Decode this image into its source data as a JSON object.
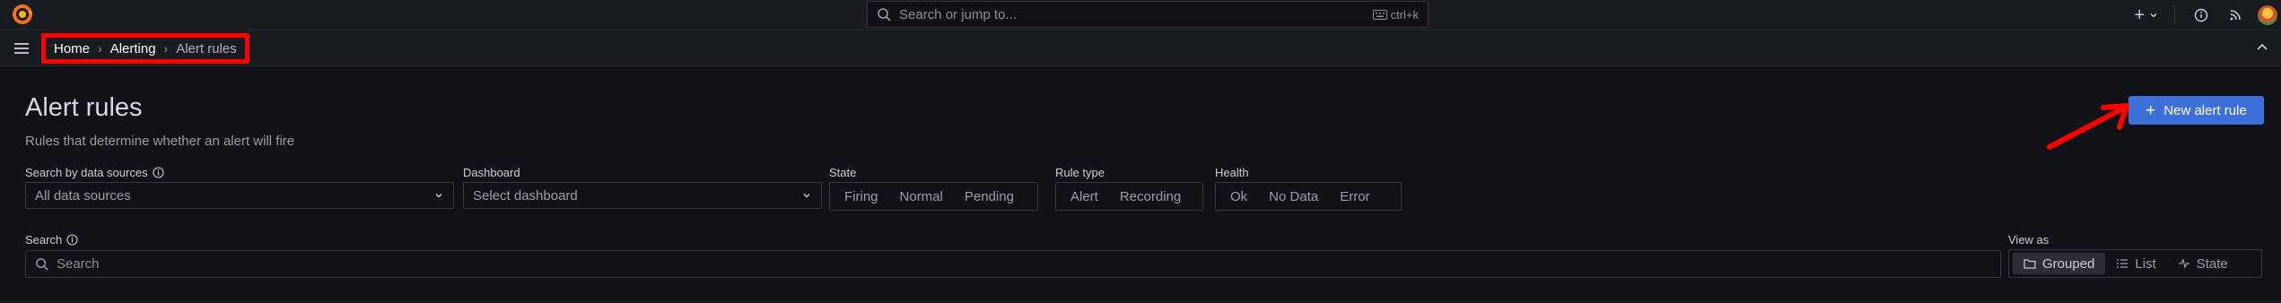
{
  "topbar": {
    "search_placeholder": "Search or jump to...",
    "search_shortcut": "ctrl+k",
    "plus_label": "+"
  },
  "breadcrumb": [
    {
      "label": "Home"
    },
    {
      "label": "Alerting"
    },
    {
      "label": "Alert rules"
    }
  ],
  "page": {
    "title": "Alert rules",
    "subtitle": "Rules that determine whether an alert will fire",
    "new_rule_label": "New alert rule"
  },
  "filters": {
    "datasource": {
      "label": "Search by data sources",
      "value": "All data sources"
    },
    "dashboard": {
      "label": "Dashboard",
      "value": "Select dashboard"
    },
    "state": {
      "label": "State",
      "options": [
        "Firing",
        "Normal",
        "Pending"
      ]
    },
    "rule_type": {
      "label": "Rule type",
      "options": [
        "Alert",
        "Recording"
      ]
    },
    "health": {
      "label": "Health",
      "options": [
        "Ok",
        "No Data",
        "Error"
      ]
    },
    "search": {
      "label": "Search",
      "placeholder": "Search"
    },
    "view_as": {
      "label": "View as",
      "options": [
        "Grouped",
        "List",
        "State"
      ],
      "selected": "Grouped"
    }
  },
  "colors": {
    "primary": "#3d71d9",
    "annotation": "#ff0000",
    "background": "#111217"
  }
}
